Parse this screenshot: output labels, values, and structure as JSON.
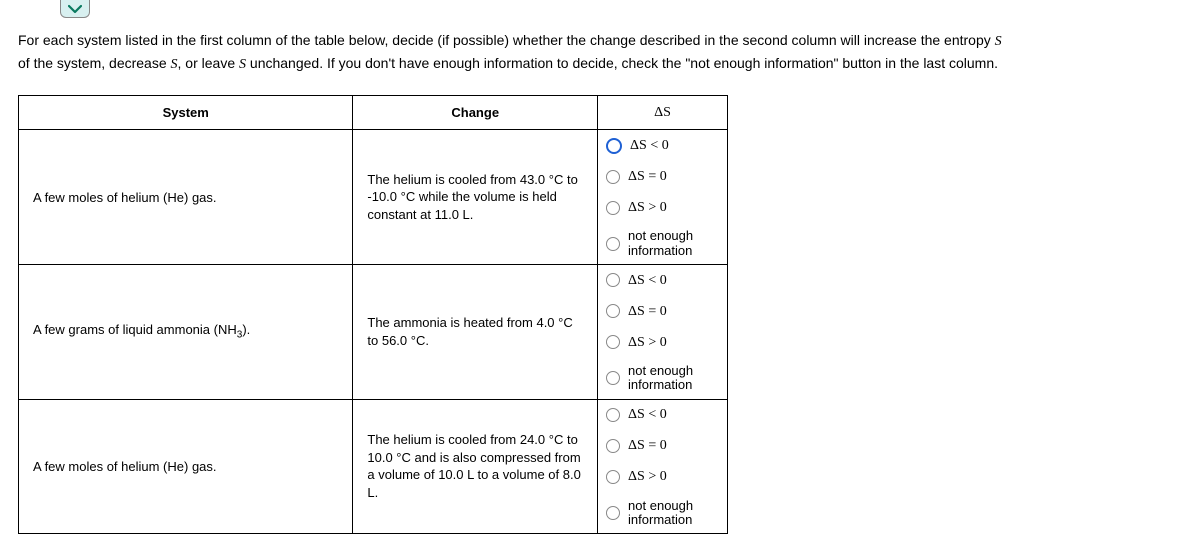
{
  "prompt": {
    "line1_pre": "For each system listed in the first column of the table below, decide (if possible) whether the change described in the second column will increase the entropy ",
    "S1": "S",
    "line2_pre": "of the system, decrease ",
    "S2": "S",
    "line2_mid": ", or leave ",
    "S3": "S",
    "line2_post": " unchanged. If you don't have enough information to decide, check the \"not enough information\" button in the last column."
  },
  "headers": {
    "system": "System",
    "change": "Change",
    "ds": "ΔS"
  },
  "options": {
    "lt": "ΔS < 0",
    "eq": "ΔS = 0",
    "gt": "ΔS > 0",
    "nei1": "not enough",
    "nei2": "information"
  },
  "rows": [
    {
      "system_pre": "A few moles of helium (",
      "system_sym": "He",
      "system_post": ") gas.",
      "change": "The helium is cooled from 43.0 °C to -10.0 °C while the volume is held constant at 11.0 L.",
      "checked": 0
    },
    {
      "system_pre": "A few grams of liquid ammonia (",
      "system_sym": "NH",
      "system_sub": "3",
      "system_post": ").",
      "change": "The ammonia is heated from 4.0 °C to 56.0 °C.",
      "checked": -1
    },
    {
      "system_pre": "A few moles of helium (",
      "system_sym": "He",
      "system_post": ") gas.",
      "change": "The helium is cooled from 24.0 °C to 10.0 °C and is also compressed from a volume of 10.0 L to a volume of 8.0 L.",
      "checked": -1
    }
  ]
}
